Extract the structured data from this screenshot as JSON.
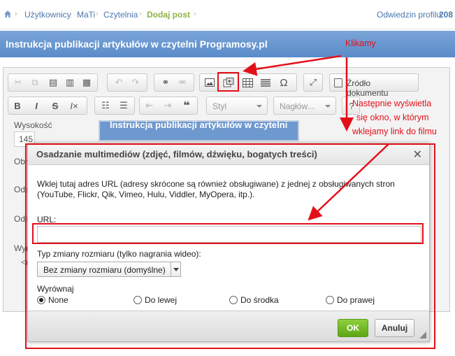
{
  "breadcrumb": {
    "items": [
      "Użytkownicy",
      "MaTi",
      "Czytelnia",
      "Dodaj post"
    ],
    "profile_label": "Odwiedzin profilu:",
    "profile_value": "208"
  },
  "page_title": "Instrukcja publikacji artykułów w czytelni Programosy.pl",
  "toolbar": {
    "source_label": "Źródło dokumentu",
    "style_combo": "Styl",
    "heading_combo": "Nagłów...",
    "icons_row1": [
      "cut-icon",
      "copy-icon",
      "paste-icon",
      "paste-text-icon",
      "paste-word-icon",
      "undo-icon",
      "redo-icon",
      "link-icon",
      "unlink-icon",
      "image-icon",
      "media-embed-icon",
      "table-icon",
      "horizontal-line-icon",
      "special-char-icon",
      "maximize-icon"
    ],
    "icons_row2": [
      "bold-icon",
      "italic-icon",
      "strike-icon",
      "remove-format-icon",
      "numbered-list-icon",
      "bulleted-list-icon",
      "outdent-icon",
      "indent-icon",
      "blockquote-icon"
    ]
  },
  "sidebar_form": {
    "height_label": "Wysokość",
    "height_value": "145",
    "labels": [
      "Obr",
      "Ods",
      "Ods",
      "Wyr"
    ],
    "values": [
      "<n"
    ]
  },
  "preview_title": "Instrukcja publikacji artykułów w czytelni",
  "dialog": {
    "title": "Osadzanie multimediów (zdjęć, filmów, dźwięku, bogatych treści)",
    "description": "Wklej tutaj adres URL (adresy skrócone są również obsługiwane) z jednej z obsługiwanych stron (YouTube, Flickr, Qik, Vimeo, Hulu, Viddler, MyOpera, itp.).",
    "url_label": "URL:",
    "url_value": "",
    "resize_label": "Typ zmiany rozmiaru (tylko nagrania wideo):",
    "resize_selected": "Bez zmiany rozmiaru (domyślne)",
    "align_label": "Wyrównaj",
    "align_options": [
      "None",
      "Do lewej",
      "Do środka",
      "Do prawej"
    ],
    "align_selected": "None",
    "ok_label": "OK",
    "cancel_label": "Anuluj"
  },
  "annotations": {
    "click_note": "Klikamy",
    "window_note": [
      "Następnie wyświetla",
      "się okno, w którym",
      "wklejamy link do filmu"
    ],
    "color": "#e3101a"
  }
}
